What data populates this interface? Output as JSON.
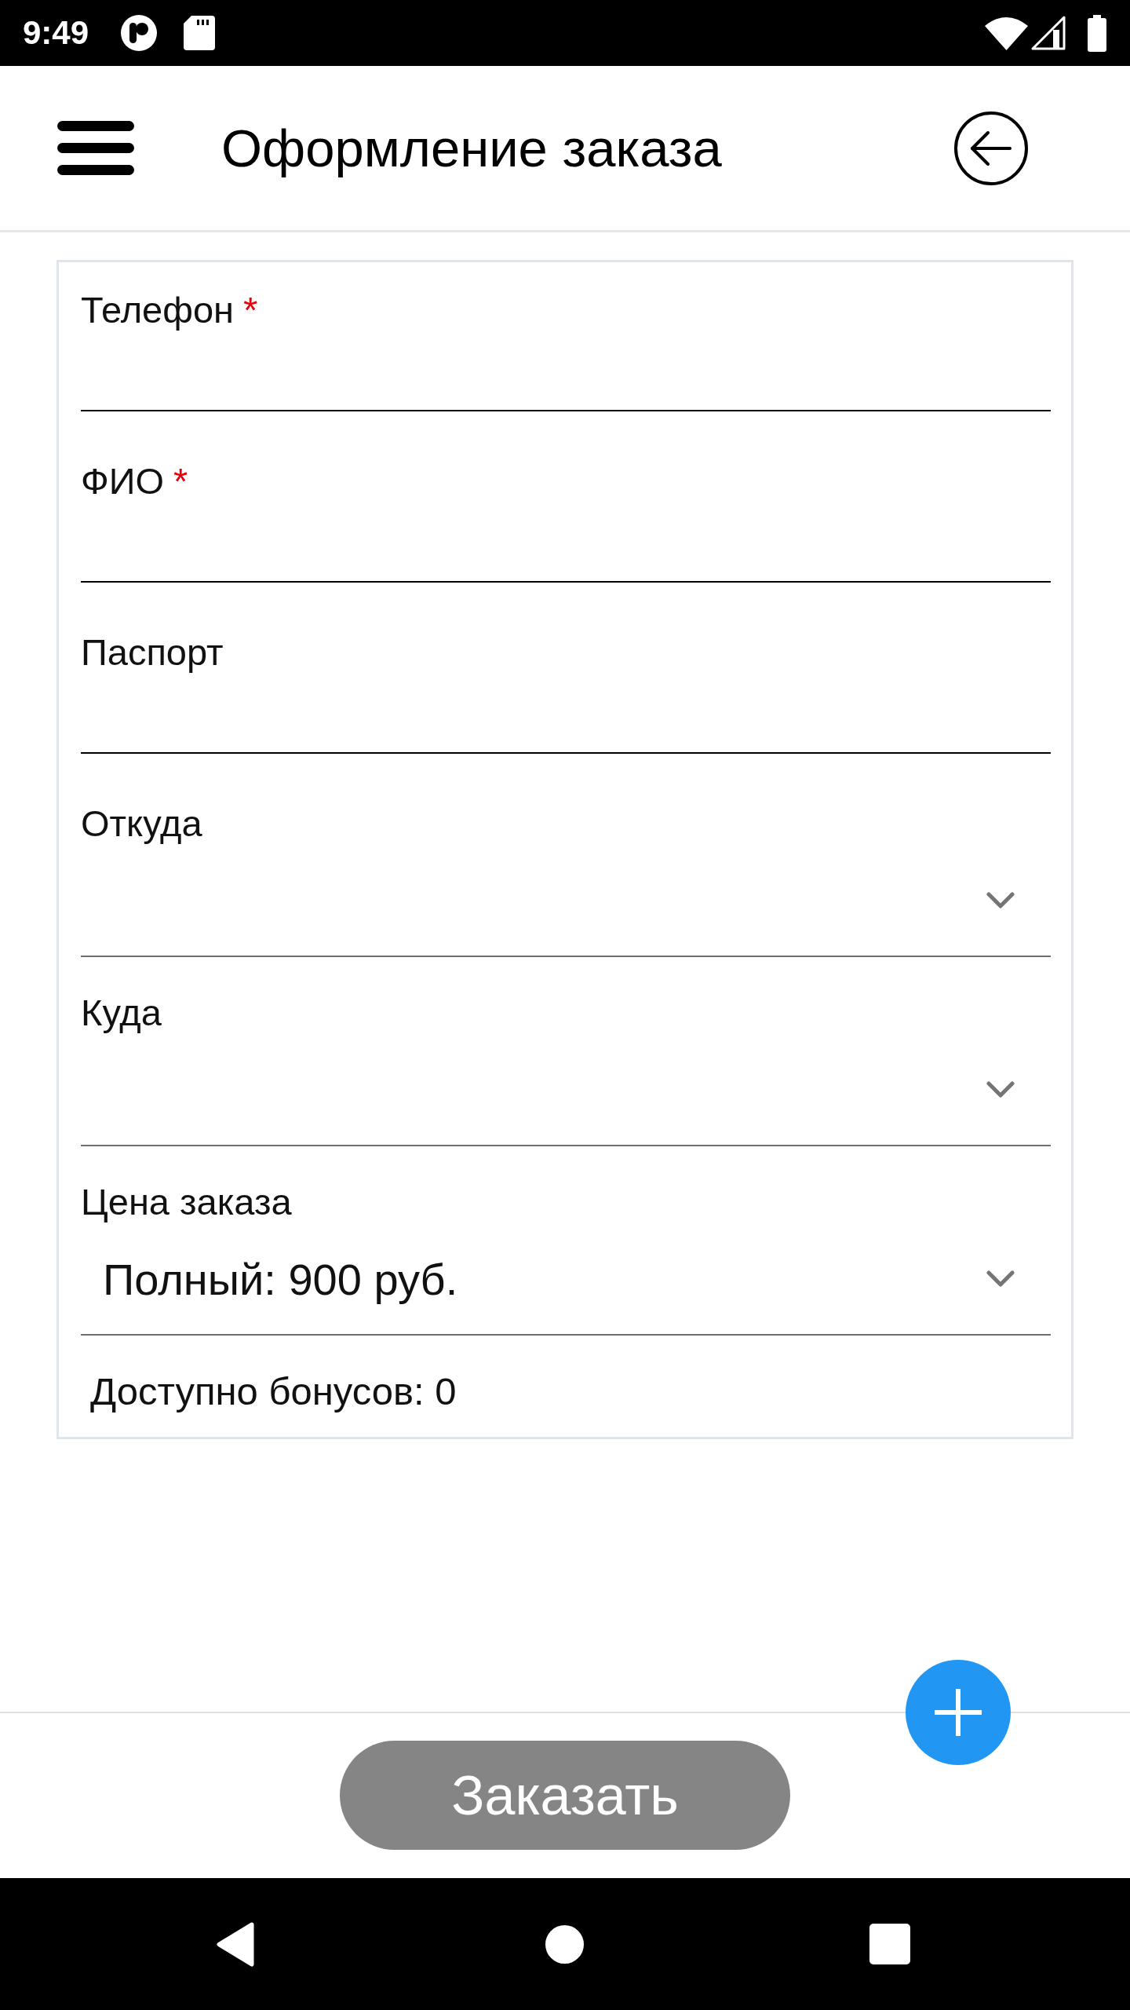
{
  "status_bar": {
    "time": "9:49"
  },
  "header": {
    "title": "Оформление заказа"
  },
  "form": {
    "fields": [
      {
        "kind": "text",
        "label": "Телефон",
        "required_mark": "*"
      },
      {
        "kind": "text",
        "label": "ФИО",
        "required_mark": "*"
      },
      {
        "kind": "text",
        "label": "Паспорт"
      },
      {
        "kind": "select",
        "label": "Откуда"
      },
      {
        "kind": "select",
        "label": "Куда"
      },
      {
        "kind": "select",
        "label": "Цена заказа",
        "value": "Полный: 900 руб."
      }
    ],
    "bonus_note": "Доступно бонусов: 0"
  },
  "order_button": {
    "label": "Заказать",
    "disabled": true
  }
}
